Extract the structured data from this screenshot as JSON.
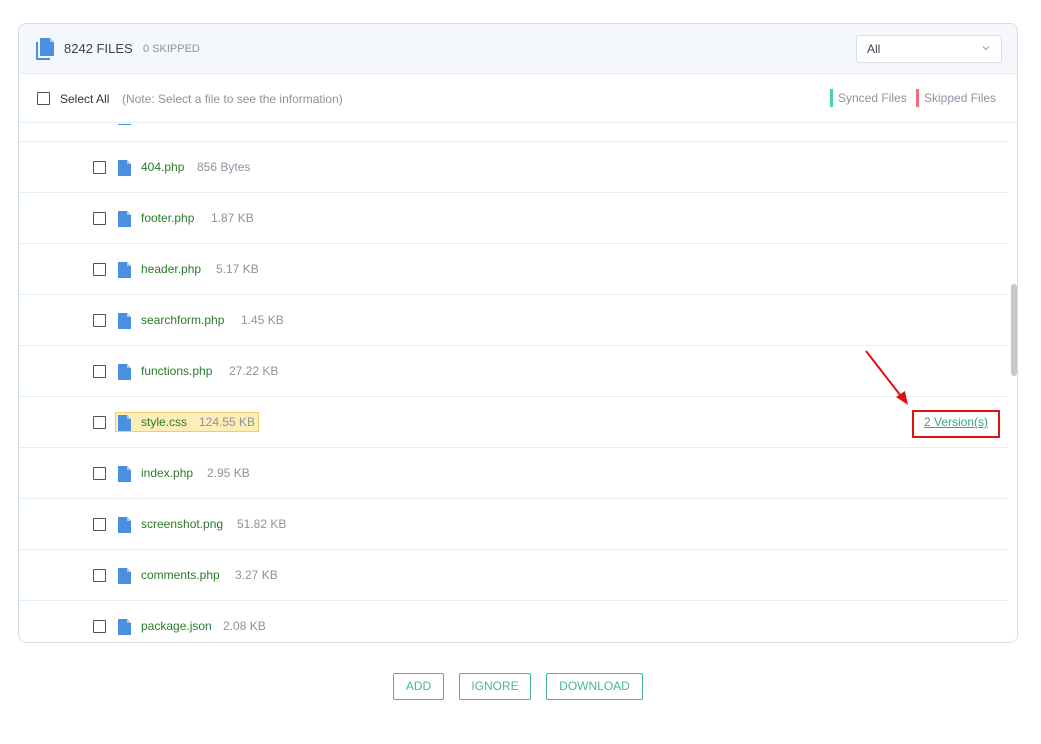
{
  "header": {
    "files_count": "8242 FILES",
    "skipped_count": "0 SKIPPED",
    "filter_value": "All"
  },
  "toolbar": {
    "select_all_label": "Select All",
    "note": "(Note: Select a file to see the information)",
    "legend_synced": "Synced Files",
    "legend_skipped": "Skipped Files"
  },
  "files": [
    {
      "name": "404.php",
      "size": "856 Bytes"
    },
    {
      "name": "footer.php",
      "size": "1.87 KB"
    },
    {
      "name": "header.php",
      "size": "5.17 KB"
    },
    {
      "name": "searchform.php",
      "size": "1.45 KB"
    },
    {
      "name": "functions.php",
      "size": "27.22 KB"
    },
    {
      "name": "style.css",
      "size": "124.55 KB",
      "versions": "2 Version(s)"
    },
    {
      "name": "index.php",
      "size": "2.95 KB"
    },
    {
      "name": "screenshot.png",
      "size": "51.82 KB"
    },
    {
      "name": "comments.php",
      "size": "3.27 KB"
    },
    {
      "name": "package.json",
      "size": "2.08 KB"
    }
  ],
  "actions": {
    "add_label": "ADD",
    "ignore_label": "IGNORE",
    "download_label": "DOWNLOAD"
  },
  "colors": {
    "accent": "#45b89c",
    "file_name": "#2a7a2a",
    "file_icon": "#4a8fe0",
    "synced": "#45d6b0",
    "skipped": "#f06a7a",
    "highlight": "#fdeeb8",
    "callout": "#e01010"
  }
}
